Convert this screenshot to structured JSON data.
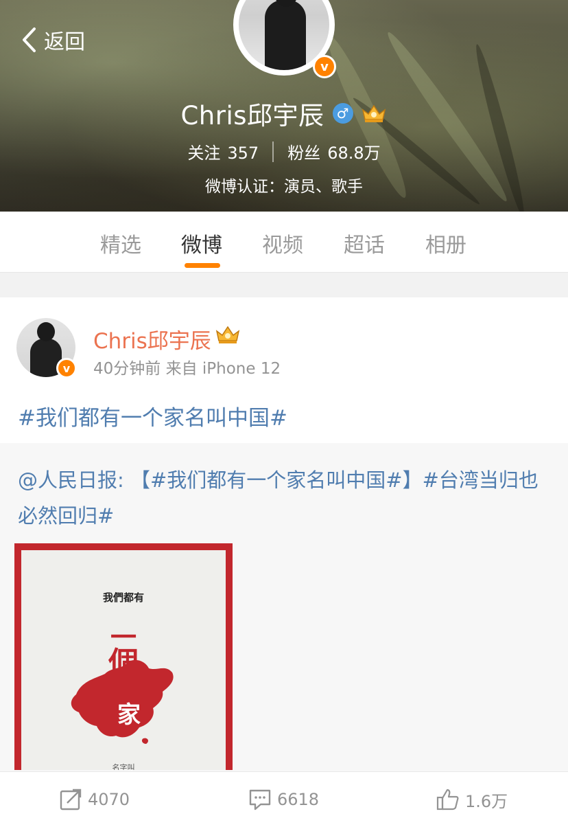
{
  "nav": {
    "back_label": "返回"
  },
  "profile": {
    "name": "Chris邱宇辰",
    "gender_symbol": "♂",
    "following_label": "关注",
    "following_count": "357",
    "followers_label": "粉丝",
    "followers_count": "68.8万",
    "verification": "微博认证：演员、歌手",
    "verified_badge": "v"
  },
  "tabs": [
    {
      "label": "精选"
    },
    {
      "label": "微博",
      "active": true
    },
    {
      "label": "视频"
    },
    {
      "label": "超话"
    },
    {
      "label": "相册"
    }
  ],
  "post": {
    "author": "Chris邱宇辰",
    "meta": "40分钟前 来自 iPhone 12",
    "text": "#我们都有一个家名叫中国#",
    "repost": {
      "text_a": "@人民日报:",
      "text_b": "【#我们都有一个家名叫中国#】",
      "text_c": "#台湾当归也必然回归#",
      "poster": {
        "line1": "我們都有",
        "line2": "一",
        "line3": "個",
        "line4": "家",
        "line5": "名字叫"
      }
    },
    "actions": {
      "repost_count": "4070",
      "comment_count": "6618",
      "like_count": "1.6万"
    }
  },
  "colors": {
    "accent": "#ff8200",
    "author_name": "#eb7350",
    "link_blue": "#507daf",
    "poster_red": "#c2272d"
  }
}
